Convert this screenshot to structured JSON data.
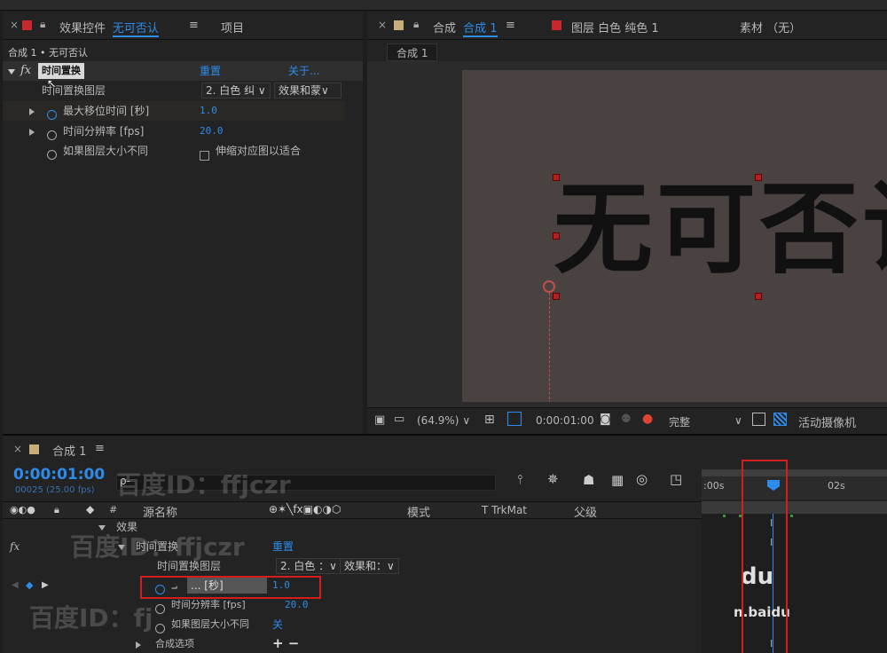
{
  "colors": {
    "accent": "#2d8ceb",
    "highlight_box": "#d21e1e",
    "label_red": "#c8282d",
    "label_tan": "#c8ae7a"
  },
  "effect_panel": {
    "close": "×",
    "tab_label": "效果控件",
    "tab_layer": "无可否认",
    "menu": "≡",
    "tab_project": "项目",
    "breadcrumb": "合成 1 • 无可否认",
    "fx": "fx",
    "effect_name": "时间置换",
    "reset": "重置",
    "about": "关于...",
    "props": [
      {
        "label": "时间置换图层",
        "value": "2. 白色 纠",
        "value2": "效果和蒙"
      },
      {
        "label": "最大移位时间 [秒]",
        "value": "1.0"
      },
      {
        "label": "时间分辨率 [fps]",
        "value": "20.0"
      },
      {
        "label": "如果图层大小不同",
        "value": "伸缩对应图以适合"
      }
    ]
  },
  "comp_panel": {
    "close": "×",
    "tab_label": "合成",
    "tab_comp": "合成 1",
    "menu": "≡",
    "tab_layer": "图层 白色 纯色 1",
    "tab_footage": "素材 （无）",
    "sub_tab": "合成 1",
    "canvas_text": "无可否认",
    "toolbar": {
      "zoom": "(64.9%)",
      "timecode": "0:00:01:00",
      "resolution": "完整",
      "camera": "活动摄像机"
    }
  },
  "timeline": {
    "close": "×",
    "tab_label": "合成 1",
    "menu": "≡",
    "timecode": "0:00:01:00",
    "frame_info": "00025 (25.00 fps)",
    "search_icon": "ρ-",
    "ruler": {
      "start": ":00s",
      "mark": "02s"
    },
    "columns": {
      "source_name": "源名称",
      "mode": "模式",
      "trkmat": "T  TrkMat",
      "parent": "父级"
    },
    "layers": [
      {
        "label": "效果"
      },
      {
        "label": "时间置换",
        "reset": "重置"
      },
      {
        "label": "时间置换图层",
        "value": "2. 白色 ：",
        "value2": "效果和："
      },
      {
        "label": "... [秒]",
        "value": "1.0"
      },
      {
        "label": "时间分辨率 [fps]",
        "value": "20.0"
      },
      {
        "label": "如果图层大小不同",
        "value": "关"
      },
      {
        "label": "合成选项",
        "value": "+ −"
      }
    ]
  },
  "watermarks": {
    "text": "百度ID：ffjczr",
    "short": "百度ID：fj",
    "logo": "du",
    "url": "n.baidu"
  }
}
